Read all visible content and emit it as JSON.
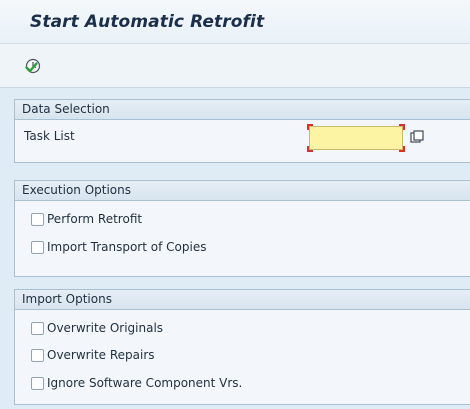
{
  "page": {
    "title": "Start Automatic Retrofit"
  },
  "toolbar": {
    "execute_icon": "execute-clock-icon"
  },
  "data_selection": {
    "header": "Data Selection",
    "task_list_label": "Task List",
    "task_list_value": "",
    "value_help_icon": "value-help-icon"
  },
  "execution_options": {
    "header": "Execution Options",
    "items": [
      {
        "label": "Perform Retrofit",
        "checked": false
      },
      {
        "label": "Import Transport of Copies",
        "checked": false
      }
    ]
  },
  "import_options": {
    "header": "Import Options",
    "items": [
      {
        "label": "Overwrite Originals",
        "checked": false
      },
      {
        "label": "Overwrite Repairs",
        "checked": false
      },
      {
        "label": "Ignore Software Component Vrs.",
        "checked": false
      }
    ]
  },
  "colors": {
    "background": "#dfebf5",
    "title": "#1b2f4a",
    "required_marker": "#d6322b",
    "input_fill": "#fcf3a3"
  }
}
